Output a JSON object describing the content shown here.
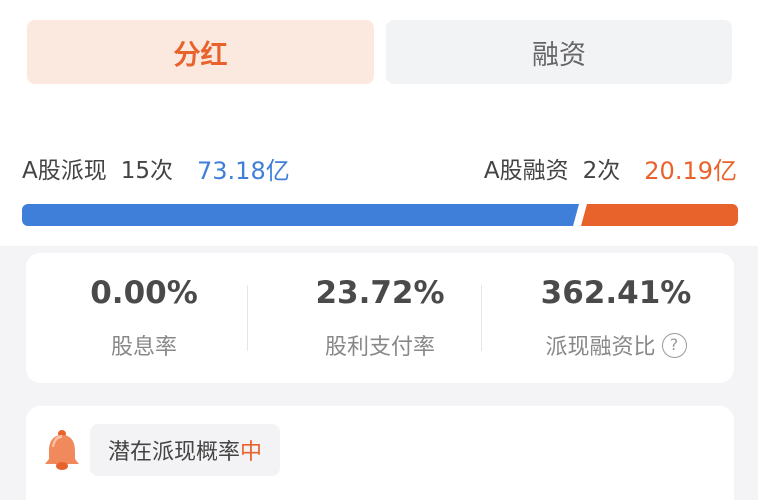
{
  "tabs": [
    {
      "label": "分红",
      "active": true
    },
    {
      "label": "融资",
      "active": false
    }
  ],
  "summary": {
    "left": {
      "label": "A股派现",
      "count": "15次",
      "amount": "73.18亿",
      "amount_value": 73.18
    },
    "right": {
      "label": "A股融资",
      "count": "2次",
      "amount": "20.19亿",
      "amount_value": 20.19
    }
  },
  "metrics": [
    {
      "value": "0.00%",
      "label": "股息率"
    },
    {
      "value": "23.72%",
      "label": "股利支付率"
    },
    {
      "value": "362.41%",
      "label": "派现融资比",
      "has_help": true
    }
  ],
  "probability": {
    "text": "潜在派现概率",
    "level": "中"
  },
  "colors": {
    "accent": "#e8622c",
    "blue": "#3f7fd9",
    "tab_active_bg": "#fbe9e0",
    "tab_inactive_bg": "#f2f3f5"
  },
  "icons": {
    "bell": "bell-icon",
    "help": "question-circle-icon"
  }
}
